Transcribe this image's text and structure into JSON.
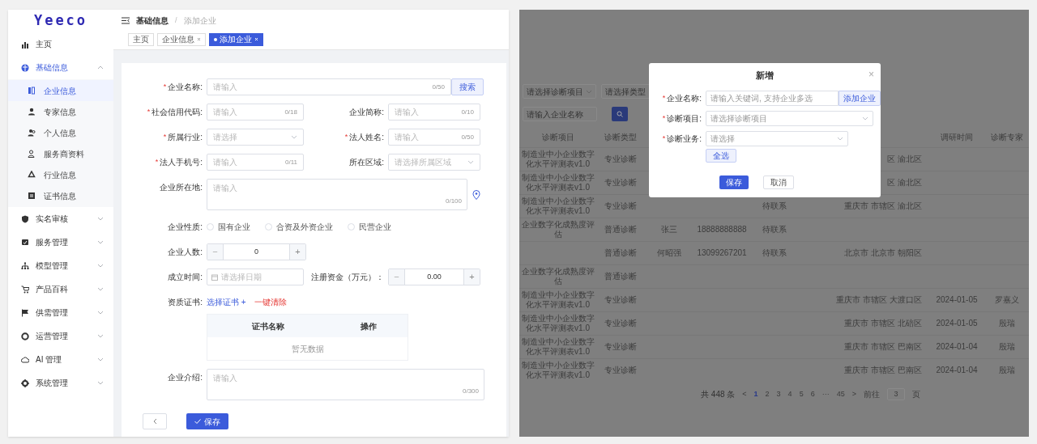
{
  "admin_screen": {
    "logo": "Yeeco",
    "sidebar": [
      {
        "label": "主页",
        "kind": "link",
        "selected": false
      },
      {
        "label": "基础信息",
        "kind": "group",
        "selected": true,
        "expanded": true,
        "children": [
          {
            "label": "企业信息",
            "selected": true
          },
          {
            "label": "专家信息",
            "selected": false
          },
          {
            "label": "个人信息",
            "selected": false
          },
          {
            "label": "服务商资料",
            "selected": false
          },
          {
            "label": "行业信息",
            "selected": false
          },
          {
            "label": "证书信息",
            "selected": false
          }
        ]
      },
      {
        "label": "实名审核",
        "kind": "group",
        "selected": false,
        "expanded": false
      },
      {
        "label": "服务管理",
        "kind": "group",
        "selected": false,
        "expanded": false
      },
      {
        "label": "模型管理",
        "kind": "group",
        "selected": false,
        "expanded": false
      },
      {
        "label": "产品百科",
        "kind": "group",
        "selected": false,
        "expanded": false
      },
      {
        "label": "供需管理",
        "kind": "group",
        "selected": false,
        "expanded": false
      },
      {
        "label": "运营管理",
        "kind": "group",
        "selected": false,
        "expanded": false
      },
      {
        "label": "AI 管理",
        "kind": "group",
        "selected": false,
        "expanded": false
      },
      {
        "label": "系统管理",
        "kind": "group",
        "selected": false,
        "expanded": false
      }
    ],
    "breadcrumb": [
      "基础信息",
      "添加企业"
    ],
    "breadcrumb_separator": "/",
    "required_mark": "*",
    "tags": [
      {
        "label": "主页",
        "closable": false,
        "selected": false
      },
      {
        "label": "企业信息",
        "closable": true,
        "selected": false
      },
      {
        "label": "添加企业",
        "closable": true,
        "selected": true
      }
    ],
    "form_rows": [
      [
        {
          "label": "企业名称:",
          "required": true,
          "kind": "input",
          "placeholder": "请输入",
          "counter": "0/50",
          "button": "搜索",
          "wide": true
        }
      ],
      [
        {
          "label": "社会信用代码:",
          "required": true,
          "kind": "input",
          "placeholder": "请输入",
          "counter": "0/18"
        },
        {
          "label": "企业简称:",
          "required": false,
          "kind": "input",
          "placeholder": "请输入",
          "counter": "0/10"
        }
      ],
      [
        {
          "label": "所属行业:",
          "required": true,
          "kind": "select",
          "placeholder": "请选择"
        },
        {
          "label": "法人姓名:",
          "required": true,
          "kind": "input",
          "placeholder": "请输入",
          "counter": "0/50"
        }
      ],
      [
        {
          "label": "法人手机号:",
          "required": true,
          "kind": "input",
          "placeholder": "请输入",
          "counter": "0/11"
        },
        {
          "label": "所在区域:",
          "required": false,
          "kind": "select",
          "placeholder": "请选择所属区域"
        }
      ],
      [
        {
          "label": "企业所在地:",
          "required": false,
          "kind": "textarea",
          "placeholder": "请输入",
          "counter": "0/100",
          "map_pin": true
        }
      ],
      [
        {
          "label": "企业性质:",
          "required": false,
          "kind": "radio",
          "options": [
            {
              "label": "国有企业",
              "selected": false
            },
            {
              "label": "合资及外资企业",
              "selected": false
            },
            {
              "label": "民营企业",
              "selected": false
            }
          ]
        }
      ],
      [
        {
          "label": "企业人数:",
          "required": false,
          "kind": "number",
          "value": "0",
          "minus": "−",
          "plus": "+"
        }
      ],
      [
        {
          "label": "成立时间:",
          "required": false,
          "kind": "date",
          "placeholder": "请选择日期"
        },
        {
          "label": "注册资金（万元）：",
          "required": false,
          "kind": "number",
          "value": "0.00",
          "minus": "−",
          "plus": "+"
        }
      ],
      [
        {
          "label": "资质证书:",
          "required": false,
          "kind": "certs",
          "add_link": "选择证书 +",
          "clear_link": "一键清除",
          "columns": [
            "证书名称",
            "操作"
          ],
          "empty": "暂无数据"
        }
      ],
      [
        {
          "label": "企业介绍:",
          "required": false,
          "kind": "textarea",
          "placeholder": "请输入",
          "counter": "0/300",
          "full": true
        }
      ]
    ],
    "save_button": "保存"
  },
  "dialog_screen": {
    "filters": [
      {
        "kind": "select",
        "placeholder": "请选择诊断项目"
      },
      {
        "kind": "select",
        "placeholder": "请选择类型"
      },
      {
        "kind": "search",
        "placeholder": "请输入企业名称"
      }
    ],
    "table": {
      "columns": [
        "诊断项目",
        "诊断类型",
        null,
        null,
        null,
        null,
        "调研时间",
        "诊断专家"
      ],
      "rows": [
        [
          "制造业中小企业数字化水平评测表v1.0",
          "专业诊断",
          null,
          null,
          null,
          "区 渝北区",
          null,
          null
        ],
        [
          "制造业中小企业数字化水平评测表v1.0",
          "专业诊断",
          null,
          null,
          null,
          "区 渝北区",
          null,
          null
        ],
        [
          "制造业中小企业数字化水平评测表v1.0",
          "专业诊断",
          null,
          null,
          "待联系",
          "重庆市 市辖区 渝北区",
          null,
          null
        ],
        [
          "企业数字化成熟度评估",
          "普通诊断",
          "张三",
          "18888888888",
          "待联系",
          null,
          null,
          null
        ],
        [
          null,
          "普通诊断",
          "何昭强",
          "13099267201",
          "待联系",
          "北京市 北京市 朝阳区",
          null,
          null
        ],
        [
          "企业数字化成熟度评估",
          "普通诊断",
          null,
          null,
          null,
          null,
          null,
          null
        ],
        [
          "制造业中小企业数字化水平评测表v1.0",
          "专业诊断",
          null,
          null,
          null,
          "重庆市 市辖区 大渡口区",
          "2024-01-05",
          "罗嘉义"
        ],
        [
          "制造业中小企业数字化水平评测表v1.0",
          "专业诊断",
          null,
          null,
          null,
          "重庆市 市辖区 北碚区",
          "2024-01-05",
          "殷瑞"
        ],
        [
          "制造业中小企业数字化水平评测表v1.0",
          "专业诊断",
          null,
          null,
          null,
          "重庆市 市辖区 巴南区",
          "2024-01-04",
          "殷瑞"
        ],
        [
          "制造业中小企业数字化水平评测表v1.0",
          "专业诊断",
          null,
          null,
          null,
          "重庆市 市辖区 巴南区",
          "2024-01-04",
          "殷瑞"
        ]
      ]
    },
    "pagination": {
      "total": "共 448 条",
      "prev": "<",
      "pages": [
        {
          "label": "1",
          "selected": true
        },
        {
          "label": "2",
          "selected": false
        },
        {
          "label": "3",
          "selected": false
        },
        {
          "label": "4",
          "selected": false
        },
        {
          "label": "5",
          "selected": false
        },
        {
          "label": "6",
          "selected": false
        },
        {
          "label": "···",
          "selected": false
        },
        {
          "label": "45",
          "selected": false
        }
      ],
      "next": ">",
      "goto": "前往",
      "goto_value": "3",
      "unit": "页"
    },
    "modal": {
      "title": "新增",
      "close": "×",
      "required_mark": "*",
      "fields": [
        {
          "label": "企业名称:",
          "required": true,
          "kind": "input",
          "placeholder": "请输入关键词, 支持企业多选",
          "button": "添加企业"
        },
        {
          "label": "诊断项目:",
          "required": true,
          "kind": "select",
          "placeholder": "请选择诊断项目"
        },
        {
          "label": "诊断业务:",
          "required": true,
          "kind": "select",
          "placeholder": "请选择",
          "button": "全选"
        }
      ],
      "buttons": [
        {
          "label": "保存",
          "kind": "primary"
        },
        {
          "label": "取消",
          "kind": "default"
        }
      ]
    }
  }
}
